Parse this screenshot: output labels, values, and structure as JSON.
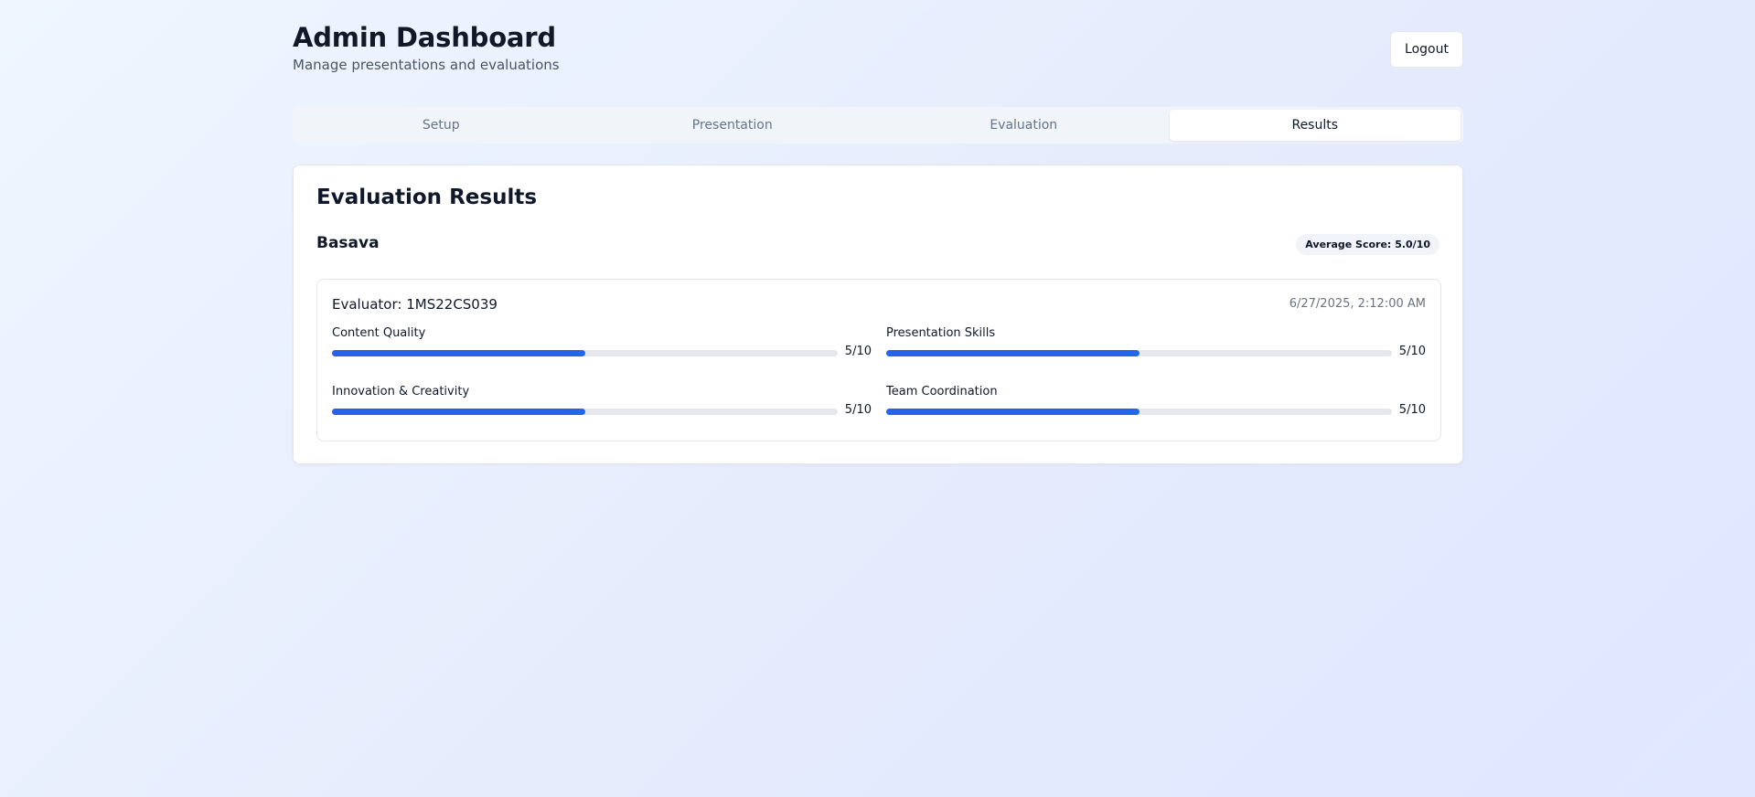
{
  "header": {
    "title": "Admin Dashboard",
    "subtitle": "Manage presentations and evaluations",
    "logout_label": "Logout"
  },
  "tabs": [
    {
      "label": "Setup",
      "active": false
    },
    {
      "label": "Presentation",
      "active": false
    },
    {
      "label": "Evaluation",
      "active": false
    },
    {
      "label": "Results",
      "active": true
    }
  ],
  "results": {
    "title": "Evaluation Results",
    "presenter": "Basava",
    "average_label": "Average Score:",
    "average_value": "5.0/10",
    "evaluation": {
      "evaluator_label": "Evaluator:",
      "evaluator_id": "1MS22CS039",
      "timestamp": "6/27/2025, 2:12:00 AM",
      "criteria": [
        {
          "label": "Content Quality",
          "score": 5,
          "max": 10,
          "score_text": "5/10"
        },
        {
          "label": "Presentation Skills",
          "score": 5,
          "max": 10,
          "score_text": "5/10"
        },
        {
          "label": "Innovation & Creativity",
          "score": 5,
          "max": 10,
          "score_text": "5/10"
        },
        {
          "label": "Team Coordination",
          "score": 5,
          "max": 10,
          "score_text": "5/10"
        }
      ]
    }
  },
  "colors": {
    "accent": "#2563eb",
    "track": "#e5e7eb"
  }
}
